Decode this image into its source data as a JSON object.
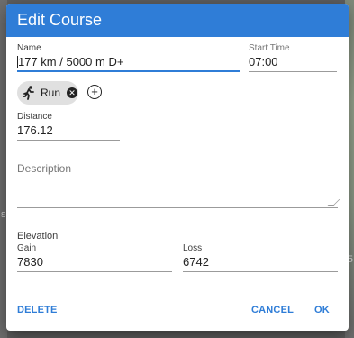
{
  "background": {
    "left_mark": "s",
    "right_mark": "5"
  },
  "dialog": {
    "title": "Edit Course",
    "name": {
      "label": "Name",
      "value": "177 km / 5000 m D+"
    },
    "start_time": {
      "label": "Start Time",
      "value": "07:00"
    },
    "activity_chip": {
      "label": "Run",
      "icon": "run-icon"
    },
    "distance": {
      "label": "Distance",
      "value": "176.12"
    },
    "description": {
      "placeholder": "Description"
    },
    "elevation": {
      "title": "Elevation",
      "gain": {
        "label": "Gain",
        "value": "7830"
      },
      "loss": {
        "label": "Loss",
        "value": "6742"
      }
    },
    "actions": {
      "delete": "DELETE",
      "cancel": "CANCEL",
      "ok": "OK"
    }
  },
  "colors": {
    "primary": "#2f7dd7",
    "header_text": "#ffffff",
    "chip_bg": "#e0e0e0"
  }
}
